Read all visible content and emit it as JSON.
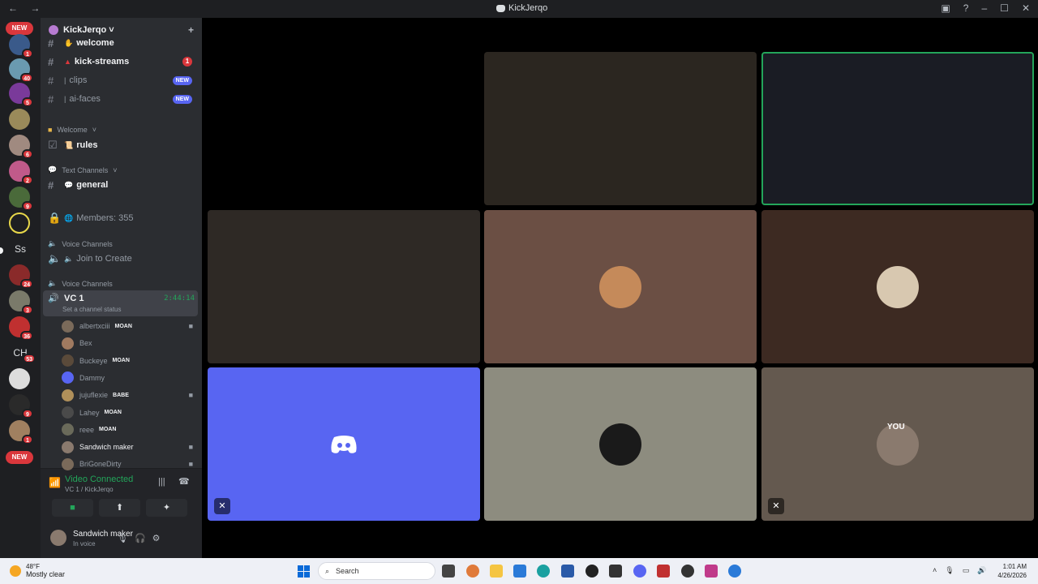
{
  "window": {
    "title": "KickJerqo",
    "nav": "← →",
    "controls": [
      "▣",
      "?",
      "–",
      "☐",
      "✕"
    ]
  },
  "guilds": {
    "new_label": "NEW",
    "badges": [
      "1",
      "40",
      "5",
      "6",
      "2",
      "9",
      "24",
      "3",
      "36",
      "53",
      "9",
      "1"
    ],
    "text_items": [
      "Ss",
      "CH"
    ]
  },
  "server": {
    "name": "KickJerqo",
    "chevron": "˅"
  },
  "channels": {
    "welcome": "welcome",
    "kick_streams": "kick-streams",
    "kick_streams_count": "1",
    "clips": "clips",
    "ai_faces": "ai-faces",
    "new_pill": "NEW",
    "cat_welcome": "Welcome",
    "rules": "rules",
    "cat_text": "Text Channels",
    "general": "general",
    "members": "Members: 355",
    "cat_voice1": "Voice Channels",
    "join_to_create": "Join to Create",
    "cat_voice2": "Voice Channels",
    "vc_name": "VC 1",
    "vc_timer": "2:44:14",
    "vc_status": "Set a channel status"
  },
  "members": [
    {
      "name": "albertxciii",
      "role": "MOAN",
      "cam": true,
      "color": "#7a6a5a"
    },
    {
      "name": "Bex",
      "role": "",
      "cam": false,
      "color": "#a07a60"
    },
    {
      "name": "Buckeye",
      "role": "MOAN",
      "cam": false,
      "color": "#5a4a3a"
    },
    {
      "name": "Dammy",
      "role": "",
      "cam": false,
      "color": "#5865f2"
    },
    {
      "name": "jujuflexie",
      "role": "BABE",
      "cam": true,
      "color": "#b0905a"
    },
    {
      "name": "Lahey",
      "role": "MOAN",
      "cam": false,
      "color": "#4a4a4a"
    },
    {
      "name": "reee",
      "role": "MOAN",
      "cam": false,
      "color": "#6a6a5a"
    },
    {
      "name": "Sandwich maker",
      "role": "",
      "cam": true,
      "color": "#8a7a6e"
    },
    {
      "name": "BriGoneDirty",
      "role": "",
      "cam": true,
      "color": "#7a6a5a"
    }
  ],
  "connection": {
    "status": "Video Connected",
    "location": "VC 1 / KickJerqo",
    "buttons": [
      "camera",
      "screen-share",
      "activities",
      "soundboard"
    ]
  },
  "user": {
    "name": "Sandwich maker",
    "status": "In voice"
  },
  "tiles": {
    "you_label": "YOU",
    "colors": {
      "brown1": "#6b4f44",
      "brown2": "#3d2a22",
      "blurple": "#5865f2",
      "olive": "#8d8c7f",
      "taupe": "#64594f"
    }
  },
  "taskbar": {
    "temp": "48°F",
    "weather": "Mostly clear",
    "search": "Search",
    "time": "1:01 AM",
    "date": "4/26/2026"
  }
}
